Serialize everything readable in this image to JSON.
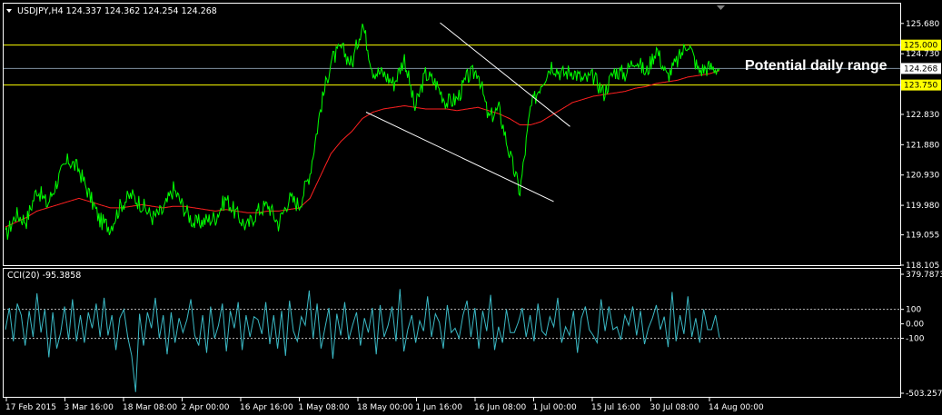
{
  "header": {
    "title": "USDJPY,H4  124.337 124.362 124.254 124.268"
  },
  "indicator": {
    "title": "CCI(20) -95.3858"
  },
  "annotation": {
    "text": "Potential daily range"
  },
  "colors": {
    "background": "#000000",
    "price": "#00ff00",
    "ma": "#ff2020",
    "cci": "#3ab8c4",
    "level_line": "#ffff00",
    "level_tag_bg": "#ffff00",
    "current_tag_bg": "#ffffff",
    "channel": "#ffffff",
    "frame": "#ffffff",
    "dotted": "#c0c0c0"
  },
  "chart_data": {
    "type": "line",
    "title": "USDJPY,H4",
    "x": [
      "17 Feb 2015",
      "3 Mar 16:00",
      "18 Mar 08:00",
      "2 Apr 00:00",
      "16 Apr 16:00",
      "1 May 08:00",
      "18 May 00:00",
      "1 Jun 16:00",
      "16 Jun 08:00",
      "1 Jul 00:00",
      "15 Jul 16:00",
      "30 Jul 08:00",
      "14 Aug 00:00"
    ],
    "price_axis": {
      "ticks": [
        "125.680",
        "124.730",
        "123.780",
        "122.830",
        "121.880",
        "120.930",
        "119.980",
        "119.055",
        "118.105"
      ],
      "ylim": [
        118.105,
        126.3
      ]
    },
    "series": [
      {
        "values": [
          119.0,
          119.7,
          119.5,
          120.5,
          120.0,
          120.8,
          121.4,
          121.1,
          120.3,
          119.5,
          119.3,
          120.0,
          120.3,
          120.0,
          119.6,
          119.8,
          120.5,
          119.9,
          119.4,
          119.5,
          119.6,
          120.2,
          119.7,
          119.3,
          119.8,
          120.0,
          119.4,
          120.2,
          120.0,
          121.0,
          123.0,
          124.5,
          124.9,
          124.4,
          125.7,
          124.2,
          124.1,
          123.8,
          124.6,
          123.0,
          124.1,
          123.8,
          123.2,
          123.3,
          124.0,
          124.2,
          122.7,
          123.0,
          121.6,
          120.4,
          123.0,
          123.8,
          124.4,
          124.1,
          124.2,
          123.9,
          124.0,
          123.5,
          124.2,
          124.1,
          124.6,
          124.1,
          124.9,
          124.0,
          124.5,
          125.1,
          124.2,
          124.3,
          124.27
        ]
      },
      {
        "name": "MA",
        "values": [
          119.3,
          119.45,
          119.6,
          119.8,
          119.9,
          120.0,
          120.1,
          120.2,
          120.1,
          120.0,
          119.9,
          119.9,
          119.95,
          120.0,
          119.95,
          119.9,
          119.95,
          119.95,
          119.9,
          119.85,
          119.8,
          119.85,
          119.8,
          119.75,
          119.75,
          119.8,
          119.8,
          119.85,
          119.9,
          120.2,
          120.9,
          121.6,
          122.0,
          122.3,
          122.7,
          122.9,
          123.0,
          123.05,
          123.1,
          123.05,
          123.0,
          123.0,
          123.0,
          122.95,
          123.0,
          123.05,
          122.95,
          122.85,
          122.7,
          122.5,
          122.5,
          122.6,
          122.8,
          123.0,
          123.2,
          123.3,
          123.4,
          123.45,
          123.5,
          123.55,
          123.65,
          123.7,
          123.8,
          123.85,
          123.9,
          124.0,
          124.05,
          124.1,
          124.2
        ]
      }
    ],
    "levels": [
      {
        "price": 125.0,
        "label": "125.000",
        "style": "level"
      },
      {
        "price": 124.268,
        "label": "124.268",
        "style": "current"
      },
      {
        "price": 123.75,
        "label": "123.750",
        "style": "level"
      }
    ],
    "channel": {
      "upper": [
        [
          "1 Jun 16:00",
          125.7
        ],
        [
          "1 Jul 00:00",
          122.45
        ]
      ],
      "lower": [
        [
          "18 May 00:00",
          122.9
        ],
        [
          "1 Jul 00:00",
          120.1
        ]
      ]
    },
    "cci": {
      "ticks": [
        "379.7873",
        "100",
        "0.00",
        "-100",
        "-503.2579"
      ],
      "ylim": [
        -503.2579,
        379.7873
      ],
      "levels": [
        100,
        -100
      ],
      "values": [
        -40,
        110,
        -120,
        140,
        60,
        -150,
        90,
        -90,
        210,
        -60,
        100,
        -230,
        80,
        -170,
        -60,
        120,
        -110,
        170,
        -120,
        60,
        -130,
        80,
        -30,
        140,
        -90,
        180,
        -80,
        60,
        -180,
        40,
        100,
        -90,
        -220,
        -470,
        70,
        -150,
        80,
        -30,
        180,
        -100,
        60,
        -210,
        80,
        -130,
        40,
        -60,
        30,
        170,
        -80,
        -150,
        60,
        -200,
        120,
        -100,
        -10,
        140,
        -190,
        90,
        -30,
        150,
        -180,
        60,
        -90,
        50,
        30,
        -70,
        150,
        -140,
        60,
        -170,
        90,
        -220,
        160,
        -50,
        -120,
        50,
        -10,
        230,
        -100,
        140,
        -170,
        -30,
        110,
        -240,
        70,
        -80,
        150,
        -110,
        -10,
        80,
        -150,
        40,
        -60,
        110,
        -210,
        130,
        -90,
        -10,
        120,
        -120,
        240,
        -190,
        -40,
        60,
        -130,
        20,
        -50,
        190,
        -90,
        70,
        10,
        -170,
        130,
        -60,
        -30,
        -100,
        60,
        160,
        -90,
        110,
        -170,
        90,
        -50,
        200,
        -180,
        -20,
        -130,
        100,
        -60,
        -60,
        10,
        110,
        -90,
        60,
        -120,
        140,
        -50,
        -80,
        50,
        -20,
        180,
        -130,
        -20,
        -80,
        90,
        -200,
        40,
        120,
        -40,
        -80,
        -130,
        170,
        -50,
        120,
        -40,
        -20,
        -110,
        60,
        -10,
        120,
        -80,
        90,
        -140,
        -30,
        40,
        130,
        -40,
        50,
        -160,
        220,
        -120,
        60,
        -70,
        190,
        -90,
        40,
        -130,
        100,
        -40,
        -40,
        60,
        -95
      ]
    }
  }
}
